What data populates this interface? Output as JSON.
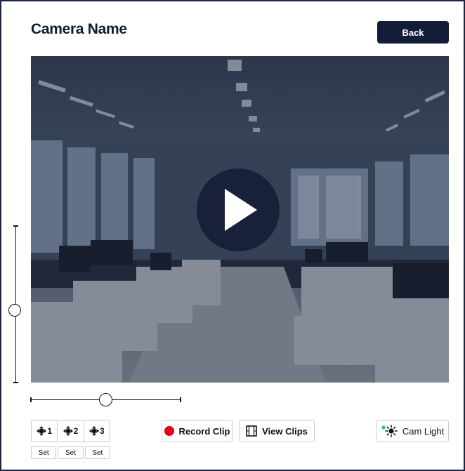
{
  "header": {
    "title": "Camera Name",
    "back_label": "Back"
  },
  "video": {
    "state": "paused"
  },
  "controls": {
    "presets": [
      {
        "label": "1",
        "icon": "crosshair-move-icon"
      },
      {
        "label": "2",
        "icon": "crosshair-move-icon"
      },
      {
        "label": "3",
        "icon": "crosshair-move-icon"
      }
    ],
    "set_labels": [
      "Set",
      "Set",
      "Set"
    ],
    "record_label": "Record Clip",
    "view_clips_label": "View Clips",
    "cam_light_label": "Cam Light",
    "tilt_level": 0.46,
    "pan_level": 0.5
  },
  "colors": {
    "accent": "#141c38",
    "record": "#e3001b",
    "light_indicator": "#22c55e"
  }
}
